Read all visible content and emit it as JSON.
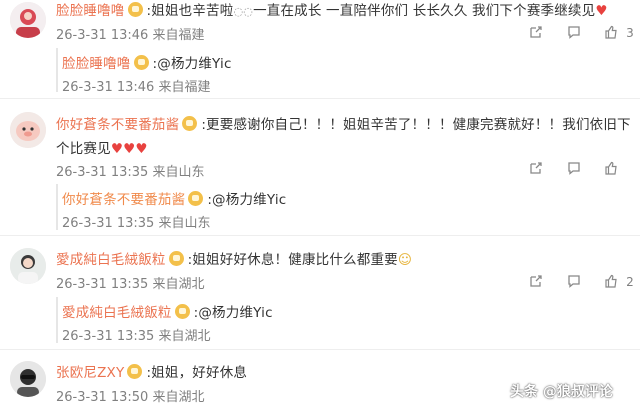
{
  "comments": [
    {
      "username": "脸脸睡噜噜",
      "text": ":姐姐也辛苦啦",
      "text_after_emoji": "一直在成长 一直陪伴你们 长长久久 我们下个赛季继续见",
      "timestamp": "26-3-31 13:46 来自福建",
      "like_count": "3",
      "reply": {
        "username": "脸脸睡噜噜",
        "text": ":@杨力维Yic",
        "timestamp": "26-3-31 13:46 来自福建"
      }
    },
    {
      "username": "你好蒼条不要番茄酱",
      "text": ":更要感谢你自己！！！姐姐辛苦了！！！健康完赛就好！！我们依旧下",
      "text_line2": "个比赛见",
      "timestamp": "26-3-31 13:35 来自山东",
      "reply": {
        "username": "你好蒼条不要番茄酱",
        "text": ":@杨力维Yic",
        "timestamp": "26-3-31 13:35 来自山东"
      }
    },
    {
      "username": "愛成純白毛絨飯粒",
      "text": ":姐姐好好休息！健康比什么都重要",
      "timestamp": "26-3-31 13:35 来自湖北",
      "like_count": "2",
      "reply": {
        "username": "愛成純白毛絨飯粒",
        "text": ":@杨力维Yic",
        "timestamp": "26-3-31 13:35 来自湖北"
      }
    },
    {
      "username": "张欧尼ZXY",
      "text": ":姐姐，好好休息",
      "timestamp": "26-3-31 13:50 来自湖北"
    }
  ],
  "watermark": "头条 @狼叔评论",
  "icons": {
    "share": "share-icon",
    "comment": "comment-icon",
    "like": "thumbs-up-icon",
    "badge": "fan-badge-icon",
    "heart": "heart-emoji"
  },
  "colors": {
    "username": "#eb7350",
    "meta": "#808080",
    "heart": "#e8423f"
  }
}
